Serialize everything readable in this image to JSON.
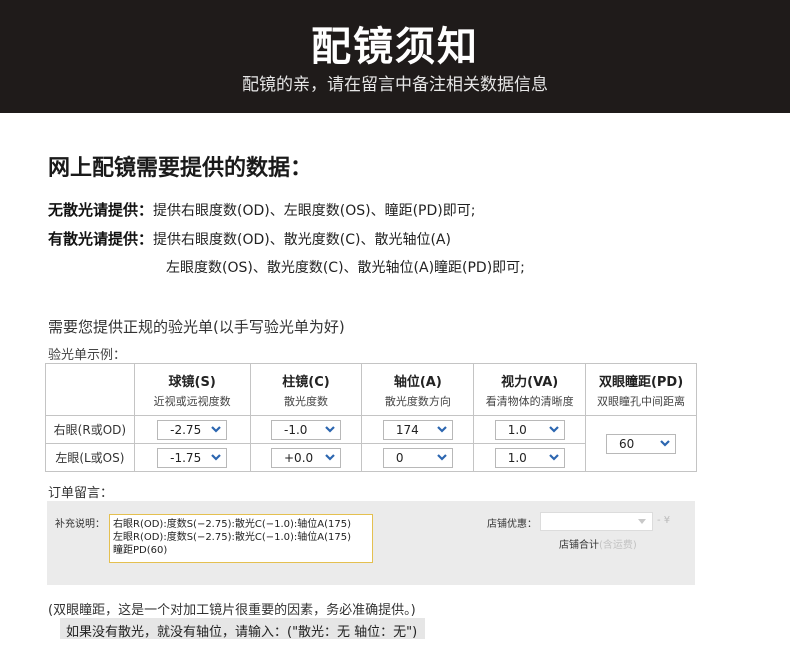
{
  "banner": {
    "title": "配镜须知",
    "subtitle": "配镜的亲，请在留言中备注相关数据信息"
  },
  "heading": "网上配镜需要提供的数据：",
  "rules": [
    {
      "label": "无散光请提供：",
      "text": "提供右眼度数(OD)、左眼度数(OS)、瞳距(PD)即可;"
    },
    {
      "label": "有散光请提供：",
      "text": "提供右眼度数(OD)、散光度数(C)、散光轴位(A)"
    },
    {
      "label": "",
      "text": "左眼度数(OS)、散光度数(C)、散光轴位(A)瞳距(PD)即可;"
    }
  ],
  "request_text": "需要您提供正规的验光单(以手写验光单为好)",
  "sample_label": "验光单示例：",
  "prescription": {
    "columns": [
      {
        "title": "球镜(S)",
        "sub": "近视或远视度数"
      },
      {
        "title": "柱镜(C)",
        "sub": "散光度数"
      },
      {
        "title": "轴位(A)",
        "sub": "散光度数方向"
      },
      {
        "title": "视力(VA)",
        "sub": "看清物体的清晰度"
      },
      {
        "title": "双眼瞳距(PD)",
        "sub": "双眼瞳孔中间距离"
      }
    ],
    "rows": [
      {
        "eye": "右眼(R或OD)",
        "sphere": "-2.75",
        "cylinder": "-1.0",
        "axis": "174",
        "va": "1.0"
      },
      {
        "eye": "左眼(L或OS)",
        "sphere": "-1.75",
        "cylinder": "+0.0",
        "axis": "0",
        "va": "1.0"
      }
    ],
    "pd": "60"
  },
  "order": {
    "label": "订单留言：",
    "note_label": "补充说明：",
    "note_text": "右眼R(OD):度数S(−2.75):散光C(−1.0):轴位A(175)\n左眼R(OD):度数S(−2.75):散光C(−1.0):轴位A(175)\n瞳距PD(60)",
    "coupon_label": "店铺优惠：",
    "coupon_extra": "- ¥",
    "store_total_label": "店铺合计",
    "store_total_muted": "(含运费)"
  },
  "footer": {
    "line1": "(双眼瞳距，这是一个对加工镜片很重要的因素，务必准确提供。)",
    "line2": "如果没有散光，就没有轴位，请输入：(\"散光：无  轴位：无\")"
  },
  "colors": {
    "banner_bg": "#1f1b1a",
    "select_chevron": "#2c66b0",
    "note_border": "#e4c050",
    "order_bg": "#ebebeb"
  }
}
